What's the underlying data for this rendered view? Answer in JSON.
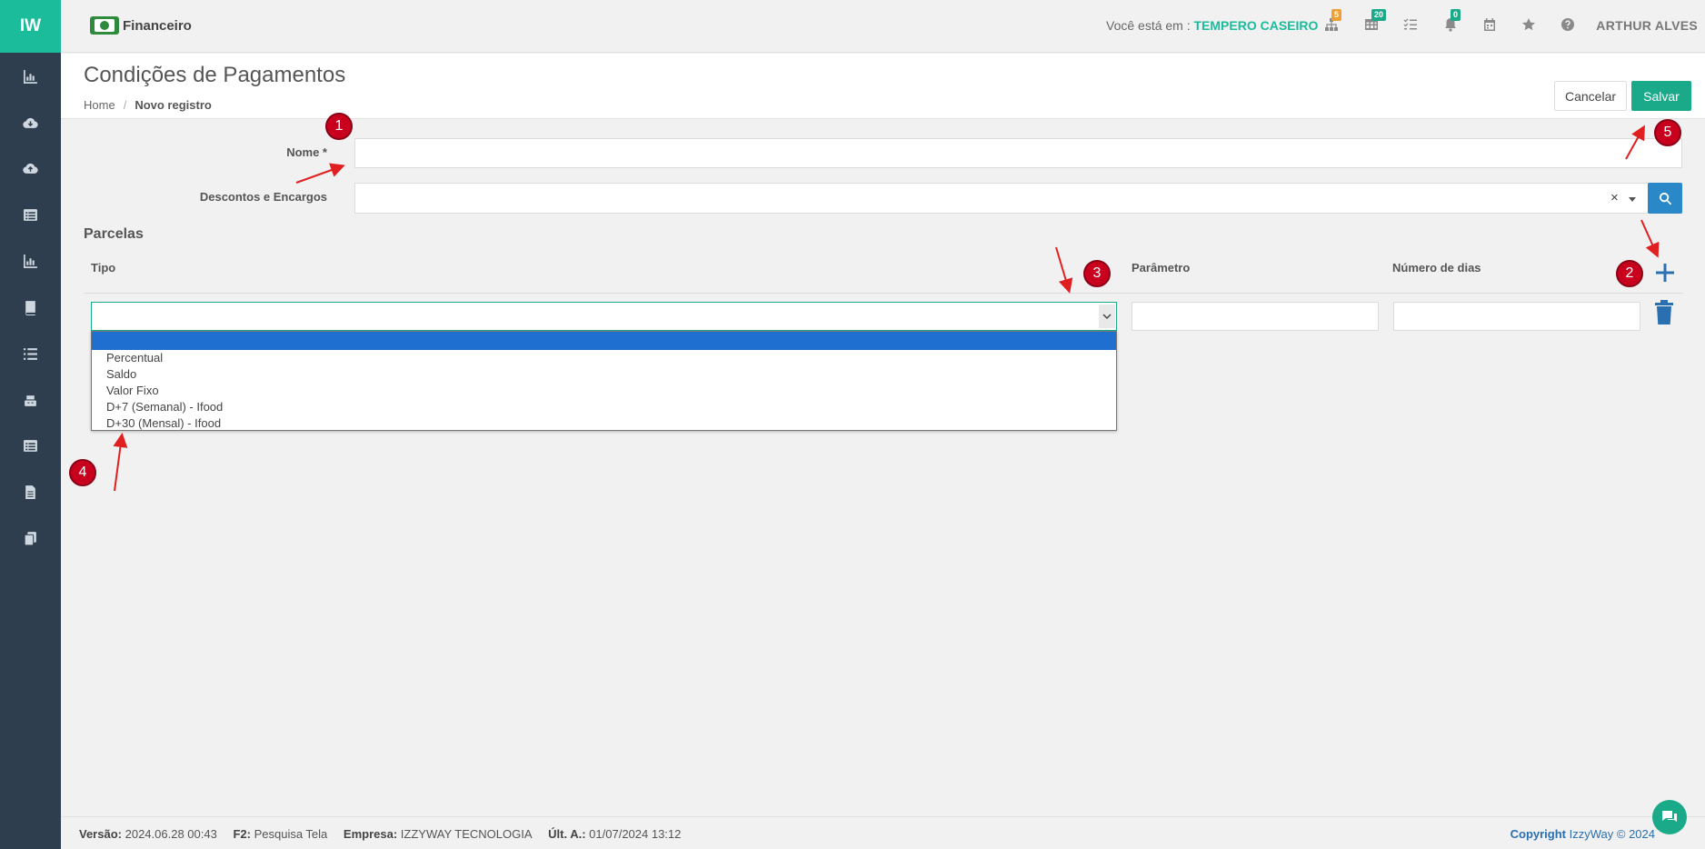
{
  "brand": {
    "logo": "IW",
    "color": "#1abc9c"
  },
  "sidebar": {
    "items": [
      {
        "icon": "bar-chart-icon"
      },
      {
        "icon": "cloud-download-icon"
      },
      {
        "icon": "cloud-upload-icon"
      },
      {
        "icon": "list-alt-icon"
      },
      {
        "icon": "bar-chart-icon"
      },
      {
        "icon": "book-icon"
      },
      {
        "icon": "list-icon"
      },
      {
        "icon": "register-icon"
      },
      {
        "icon": "list-alt-icon"
      },
      {
        "icon": "file-icon"
      },
      {
        "icon": "copy-icon"
      }
    ]
  },
  "header": {
    "module": "Financeiro",
    "location_prefix": "Você está em :",
    "location_value": "TEMPERO CASEIRO",
    "badges": {
      "sitemap": "5",
      "table": "20",
      "notifications": "0"
    },
    "user": "ARTHUR ALVES"
  },
  "page": {
    "title": "Condições de Pagamentos",
    "breadcrumb": {
      "home": "Home",
      "separator": "/",
      "current": "Novo registro"
    },
    "cancel_label": "Cancelar",
    "save_label": "Salvar"
  },
  "form": {
    "nome_label": "Nome *",
    "nome_value": "",
    "descontos_label": "Descontos e Encargos",
    "descontos_value": "",
    "clear_symbol": "×"
  },
  "parcelas": {
    "title": "Parcelas",
    "col_tipo": "Tipo",
    "col_parametro": "Parâmetro",
    "col_dias": "Número de dias",
    "tipo_options": [
      "",
      "Percentual",
      "Saldo",
      "Valor Fixo",
      "D+7 (Semanal) - Ifood",
      "D+30 (Mensal) - Ifood"
    ],
    "tipo_selected_index": 0
  },
  "annotations": [
    "1",
    "2",
    "3",
    "4",
    "5"
  ],
  "footer": {
    "versao_label": "Versão:",
    "versao_value": "2024.06.28 00:43",
    "f2_label": "F2:",
    "f2_value": "Pesquisa Tela",
    "empresa_label": "Empresa:",
    "empresa_value": "IZZYWAY TECNOLOGIA",
    "ult_label": "Últ. A.:",
    "ult_value": "01/07/2024 13:12",
    "copyright_label": "Copyright",
    "copyright_value": "IzzyWay © 2024"
  },
  "colors": {
    "accent": "#1abc9c",
    "primary": "#2a88c8",
    "sidebar": "#2e3e4e",
    "annotation": "#c8001e"
  }
}
